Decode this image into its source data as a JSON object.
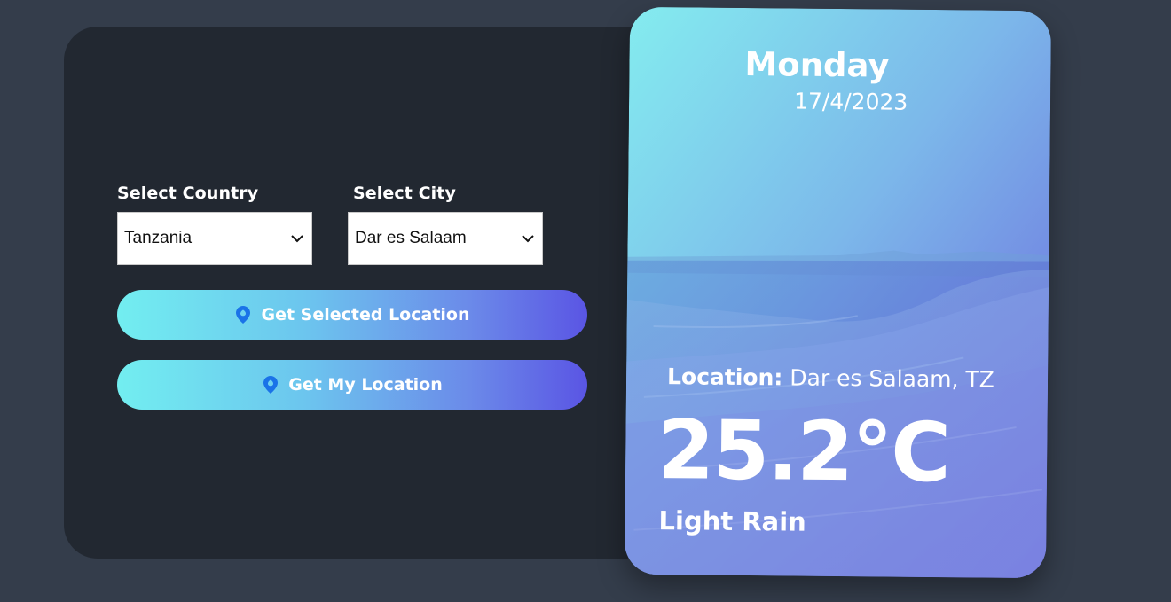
{
  "form": {
    "country_label": "Select Country",
    "city_label": "Select City",
    "country_value": "Tanzania",
    "city_value": "Dar es Salaam"
  },
  "buttons": {
    "selected_location": "Get Selected Location",
    "my_location": "Get My Location",
    "icon": "location-pin-icon"
  },
  "weather": {
    "day": "Monday",
    "date": "17/4/2023",
    "location_key": "Location:",
    "location_value": "Dar es Salaam, TZ",
    "temperature": "25.2°C",
    "description": "Light Rain"
  },
  "colors": {
    "page_bg": "#343d4b",
    "panel_bg": "#222831",
    "gradient_start": "#72eef0",
    "gradient_end": "#5a55e4",
    "pin": "#1a73e8"
  }
}
